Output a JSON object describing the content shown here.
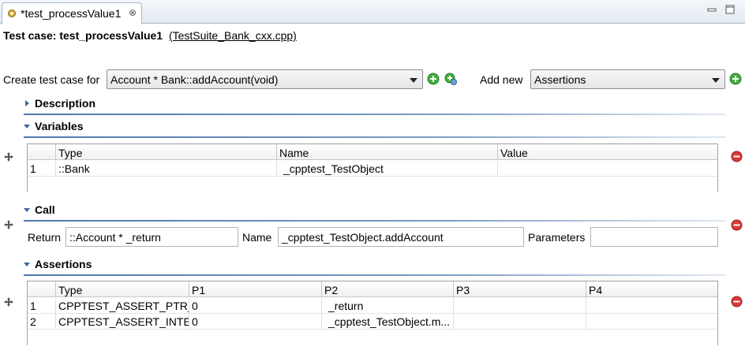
{
  "tab": {
    "title": "*test_processValue1",
    "close_glyph": "⊗"
  },
  "header": {
    "label": "Test case: test_processValue1",
    "link": "(TestSuite_Bank_cxx.cpp)"
  },
  "toolbar": {
    "create_label": "Create test case for",
    "create_value": "Account * Bank::addAccount(void)",
    "add_new_label": "Add new",
    "add_new_value": "Assertions"
  },
  "sections": {
    "description": "Description",
    "variables": "Variables",
    "call": "Call",
    "assertions": "Assertions"
  },
  "variables_table": {
    "columns": [
      "Type",
      "Name",
      "Value"
    ],
    "rows": [
      {
        "num": "1",
        "type": "::Bank",
        "name": "_cpptest_TestObject",
        "value": ""
      }
    ]
  },
  "call": {
    "return_label": "Return",
    "return_value": "::Account * _return",
    "name_label": "Name",
    "name_value": "_cpptest_TestObject.addAccount",
    "parameters_label": "Parameters",
    "parameters_value": ""
  },
  "assertions_table": {
    "columns": [
      "Type",
      "P1",
      "P2",
      "P3",
      "P4"
    ],
    "rows": [
      {
        "num": "1",
        "type": "CPPTEST_ASSERT_PTR_...",
        "p1": "0",
        "p2": "_return",
        "p3": "",
        "p4": ""
      },
      {
        "num": "2",
        "type": "CPPTEST_ASSERT_INTE...",
        "p1": "0",
        "p2": "_cpptest_TestObject.m...",
        "p3": "",
        "p4": ""
      }
    ]
  },
  "colors": {
    "section_accent": "#3a6aa6",
    "add_button": "#3fae3f",
    "remove_button": "#d93a3a"
  },
  "icons": [
    "gear-icon",
    "close-icon",
    "minimize-icon",
    "maximize-icon",
    "add-icon",
    "add-dependent-icon",
    "move-icon",
    "remove-icon"
  ]
}
